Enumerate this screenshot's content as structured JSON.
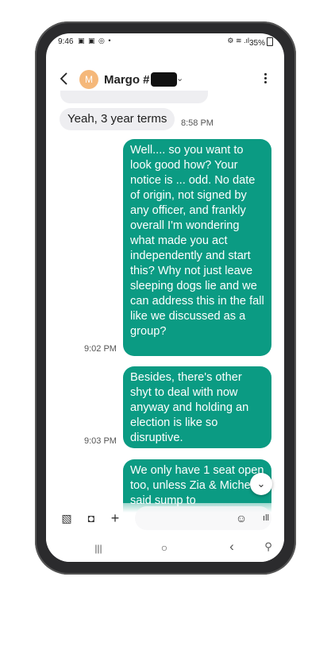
{
  "status_bar": {
    "time": "9:46",
    "left_icons": "▣ ▣ ◎ •",
    "right_icons": "⚙ ≋ .ıl",
    "battery": "35%"
  },
  "header": {
    "back_icon": "back-arrow-icon",
    "avatar_letter": "M",
    "avatar_color": "#f5b87a",
    "contact_name": "Margo #",
    "chevron": "⌄"
  },
  "messages": [
    {
      "type": "received",
      "text": "Yeah, 3 year terms",
      "time": "8:58 PM"
    },
    {
      "type": "sent",
      "text": "Well.... so you want to look good how? Your notice is ... odd. No date of origin, not signed by any officer, and frankly overall I'm wondering what made you act independently and start this? Why not just leave sleeping dogs lie and we can address this in the fall like we discussed as a group?",
      "time": "9:02 PM"
    },
    {
      "type": "sent",
      "text": "Besides, there's other shyt to deal with now anyway and holding an election is like so disruptive.",
      "time": "9:03 PM"
    },
    {
      "type": "sent",
      "text": "We only have 1 seat open too, unless Zia & Michelle said sump to",
      "time": ""
    }
  ],
  "composer": {
    "gallery_icon": "▧",
    "camera_icon": "◘",
    "plus_icon": "+",
    "emoji_icon": "☺",
    "voice_icon": "ıll",
    "scroll_down_icon": "⌄"
  },
  "nav": {
    "recents": "|||",
    "home": "○",
    "back": "‹",
    "accessibility": "⚲"
  },
  "colors": {
    "sent_bubble": "#0b9b83",
    "received_bubble": "#eeeef1"
  }
}
